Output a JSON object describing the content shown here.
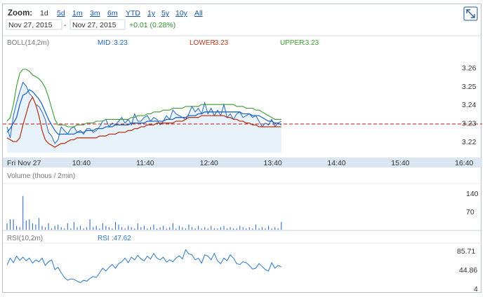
{
  "toolbar": {
    "zoom_label": "Zoom:",
    "zoom_options": [
      "1d",
      "5d",
      "1m",
      "3m",
      "6m",
      "YTD",
      "1y",
      "5y",
      "10y",
      "All"
    ],
    "date_from": "Nov 27, 2015",
    "date_sep": "-",
    "date_to": "Nov 27, 2015",
    "change": "+0.01 (0.28%)",
    "expand_icon": "expand-icon"
  },
  "colors": {
    "price": "#2266c0",
    "mid": "#2266c0",
    "lower": "#b83a1e",
    "upper": "#3a9a30",
    "reference": "#c01010",
    "volume": "#336fbf",
    "rsi": "#2a76c6",
    "area": "#e8f2fb"
  },
  "chart_data": [
    {
      "type": "line",
      "title": "",
      "indicator_label": "BOLL(14,2m)",
      "legend": [
        {
          "key": "MID",
          "value": "3.23"
        },
        {
          "key": "LOWER",
          "value": "3.23"
        },
        {
          "key": "UPPER",
          "value": "3.23"
        }
      ],
      "x_axis": {
        "date_label": "Fri Nov 27",
        "tick_labels": [
          "10:40",
          "11:40",
          "12:40",
          "13:40",
          "14:40",
          "15:40",
          "16:40"
        ],
        "range": [
          "09:30",
          "16:55"
        ]
      },
      "y_axis": {
        "tick_labels": [
          "3.26",
          "3.25",
          "3.24",
          "3.23",
          "3.22"
        ],
        "range": [
          3.214,
          3.276
        ],
        "position": "right"
      },
      "reference_line": 3.2295,
      "grid": false,
      "x": [
        "09:30",
        "09:33",
        "09:36",
        "09:39",
        "09:42",
        "09:45",
        "09:48",
        "09:51",
        "09:54",
        "09:57",
        "10:00",
        "10:03",
        "10:06",
        "10:09",
        "10:12",
        "10:15",
        "10:18",
        "10:21",
        "10:24",
        "10:27",
        "10:30",
        "10:33",
        "10:36",
        "10:39",
        "10:42",
        "10:45",
        "10:48",
        "10:51",
        "10:54",
        "10:57",
        "11:00",
        "11:03",
        "11:06",
        "11:09",
        "11:12",
        "11:15",
        "11:18",
        "11:21",
        "11:24",
        "11:27",
        "11:30",
        "11:33",
        "11:36",
        "11:39",
        "11:42",
        "11:45",
        "11:48",
        "11:51",
        "11:54",
        "11:57",
        "12:00",
        "12:03",
        "12:06",
        "12:09",
        "12:12",
        "12:15",
        "12:18",
        "12:21",
        "12:24",
        "12:27",
        "12:30",
        "12:33",
        "12:36",
        "12:39",
        "12:42",
        "12:45",
        "12:48",
        "12:51",
        "12:54",
        "12:57",
        "13:00",
        "13:03",
        "13:06",
        "13:09",
        "13:12",
        "13:15",
        "13:18",
        "13:21",
        "13:24",
        "13:27",
        "13:30",
        "13:33",
        "13:36",
        "13:39",
        "13:42",
        "13:45",
        "13:48"
      ],
      "series": [
        {
          "name": "",
          "values": [
            3.228,
            3.222,
            3.234,
            3.241,
            3.247,
            3.252,
            3.25,
            3.246,
            3.244,
            3.24,
            3.239,
            3.236,
            3.232,
            3.225,
            3.223,
            3.219,
            3.221,
            3.228,
            3.226,
            3.224,
            3.227,
            3.228,
            3.225,
            3.226,
            3.224,
            3.227,
            3.227,
            3.225,
            3.226,
            3.228,
            3.231,
            3.232,
            3.228,
            3.23,
            3.229,
            3.231,
            3.233,
            3.23,
            3.232,
            3.229,
            3.235,
            3.231,
            3.231,
            3.233,
            3.234,
            3.231,
            3.233,
            3.232,
            3.229,
            3.231,
            3.234,
            3.232,
            3.237,
            3.235,
            3.234,
            3.233,
            3.232,
            3.235,
            3.239,
            3.236,
            3.238,
            3.235,
            3.241,
            3.235,
            3.238,
            3.234,
            3.237,
            3.234,
            3.24,
            3.233,
            3.235,
            3.232,
            3.235,
            3.236,
            3.233,
            3.234,
            3.235,
            3.233,
            3.234,
            3.231,
            3.228,
            3.23,
            3.229,
            3.232,
            3.228,
            3.23,
            3.231
          ]
        },
        {
          "name": "MID",
          "values": [
            3.225,
            3.227,
            3.23,
            3.233,
            3.24,
            3.245,
            3.246,
            3.248,
            3.247,
            3.245,
            3.243,
            3.24,
            3.236,
            3.232,
            3.229,
            3.226,
            3.224,
            3.224,
            3.224,
            3.224,
            3.224,
            3.224,
            3.225,
            3.225,
            3.225,
            3.226,
            3.226,
            3.226,
            3.227,
            3.227,
            3.227,
            3.228,
            3.228,
            3.228,
            3.229,
            3.229,
            3.229,
            3.229,
            3.229,
            3.23,
            3.23,
            3.23,
            3.23,
            3.23,
            3.231,
            3.231,
            3.231,
            3.231,
            3.231,
            3.231,
            3.232,
            3.232,
            3.232,
            3.233,
            3.233,
            3.233,
            3.233,
            3.234,
            3.234,
            3.234,
            3.235,
            3.235,
            3.236,
            3.236,
            3.236,
            3.236,
            3.236,
            3.236,
            3.236,
            3.236,
            3.236,
            3.236,
            3.236,
            3.236,
            3.235,
            3.235,
            3.235,
            3.234,
            3.234,
            3.234,
            3.233,
            3.232,
            3.231,
            3.231,
            3.23,
            3.23,
            3.229
          ]
        },
        {
          "name": "LOWER",
          "values": [
            3.222,
            3.221,
            3.22,
            3.22,
            3.222,
            3.229,
            3.235,
            3.241,
            3.244,
            3.24,
            3.234,
            3.226,
            3.221,
            3.219,
            3.218,
            3.217,
            3.218,
            3.219,
            3.219,
            3.22,
            3.221,
            3.221,
            3.222,
            3.222,
            3.222,
            3.222,
            3.222,
            3.222,
            3.222,
            3.223,
            3.223,
            3.223,
            3.224,
            3.224,
            3.224,
            3.225,
            3.225,
            3.225,
            3.226,
            3.226,
            3.227,
            3.227,
            3.228,
            3.228,
            3.229,
            3.229,
            3.229,
            3.23,
            3.23,
            3.23,
            3.23,
            3.23,
            3.23,
            3.231,
            3.231,
            3.231,
            3.232,
            3.233,
            3.233,
            3.233,
            3.233,
            3.234,
            3.234,
            3.234,
            3.234,
            3.234,
            3.234,
            3.234,
            3.234,
            3.233,
            3.233,
            3.232,
            3.232,
            3.231,
            3.231,
            3.23,
            3.23,
            3.229,
            3.229,
            3.228,
            3.228,
            3.228,
            3.228,
            3.228,
            3.228,
            3.228,
            3.228
          ]
        },
        {
          "name": "UPPER",
          "values": [
            3.231,
            3.233,
            3.24,
            3.25,
            3.257,
            3.259,
            3.259,
            3.258,
            3.256,
            3.255,
            3.254,
            3.252,
            3.249,
            3.244,
            3.238,
            3.232,
            3.229,
            3.229,
            3.229,
            3.228,
            3.228,
            3.228,
            3.229,
            3.229,
            3.229,
            3.23,
            3.23,
            3.23,
            3.231,
            3.231,
            3.231,
            3.232,
            3.232,
            3.232,
            3.232,
            3.232,
            3.232,
            3.232,
            3.232,
            3.233,
            3.233,
            3.234,
            3.234,
            3.234,
            3.235,
            3.235,
            3.236,
            3.236,
            3.236,
            3.237,
            3.237,
            3.237,
            3.238,
            3.238,
            3.238,
            3.238,
            3.239,
            3.239,
            3.239,
            3.239,
            3.239,
            3.24,
            3.24,
            3.24,
            3.24,
            3.24,
            3.24,
            3.24,
            3.24,
            3.24,
            3.24,
            3.24,
            3.239,
            3.239,
            3.239,
            3.238,
            3.238,
            3.238,
            3.237,
            3.237,
            3.236,
            3.235,
            3.234,
            3.233,
            3.232,
            3.232,
            3.232
          ]
        }
      ]
    },
    {
      "type": "bar",
      "title": "Volume (thous / 2min)",
      "y_axis": {
        "tick_labels": [
          "140",
          "70"
        ],
        "range": [
          0,
          175
        ],
        "position": "right"
      },
      "values": [
        25,
        40,
        40,
        15,
        10,
        130,
        35,
        40,
        25,
        20,
        45,
        15,
        10,
        25,
        5,
        15,
        20,
        10,
        5,
        25,
        5,
        30,
        10,
        15,
        5,
        10,
        40,
        10,
        15,
        5,
        25,
        15,
        10,
        5,
        30,
        20,
        10,
        5,
        15,
        10,
        5,
        25,
        10,
        15,
        5,
        10,
        20,
        5,
        10,
        15,
        5,
        10,
        25,
        5,
        15,
        10,
        5,
        20,
        10,
        5,
        15,
        5,
        10,
        5,
        15,
        5,
        5,
        10,
        15,
        5,
        10,
        5,
        5,
        15,
        10,
        5,
        10,
        5,
        20,
        5,
        10,
        5,
        15,
        5,
        10,
        5,
        30
      ]
    },
    {
      "type": "line",
      "title": "RSI(10,2m)",
      "legend": [
        {
          "key": "RSI",
          "value": "47.62"
        }
      ],
      "y_axis": {
        "tick_labels": [
          "85.71",
          "44.86",
          "4"
        ],
        "range": [
          4,
          85.71
        ],
        "position": "right"
      },
      "series": [
        {
          "name": "RSI",
          "values": [
            55,
            70,
            60,
            74,
            65,
            72,
            64,
            70,
            59,
            66,
            62,
            70,
            54,
            62,
            66,
            45,
            50,
            38,
            28,
            22,
            25,
            24,
            20,
            17,
            22,
            20,
            26,
            30,
            28,
            38,
            48,
            42,
            50,
            56,
            48,
            58,
            62,
            70,
            60,
            72,
            66,
            76,
            68,
            64,
            74,
            68,
            80,
            70,
            66,
            72,
            61,
            66,
            62,
            70,
            75,
            68,
            88,
            79,
            77,
            66,
            70,
            59,
            77,
            74,
            66,
            80,
            64,
            58,
            70,
            64,
            77,
            70,
            58,
            56,
            62,
            60,
            54,
            46,
            48,
            58,
            52,
            45,
            42,
            60,
            48,
            54,
            51
          ]
        }
      ]
    }
  ]
}
